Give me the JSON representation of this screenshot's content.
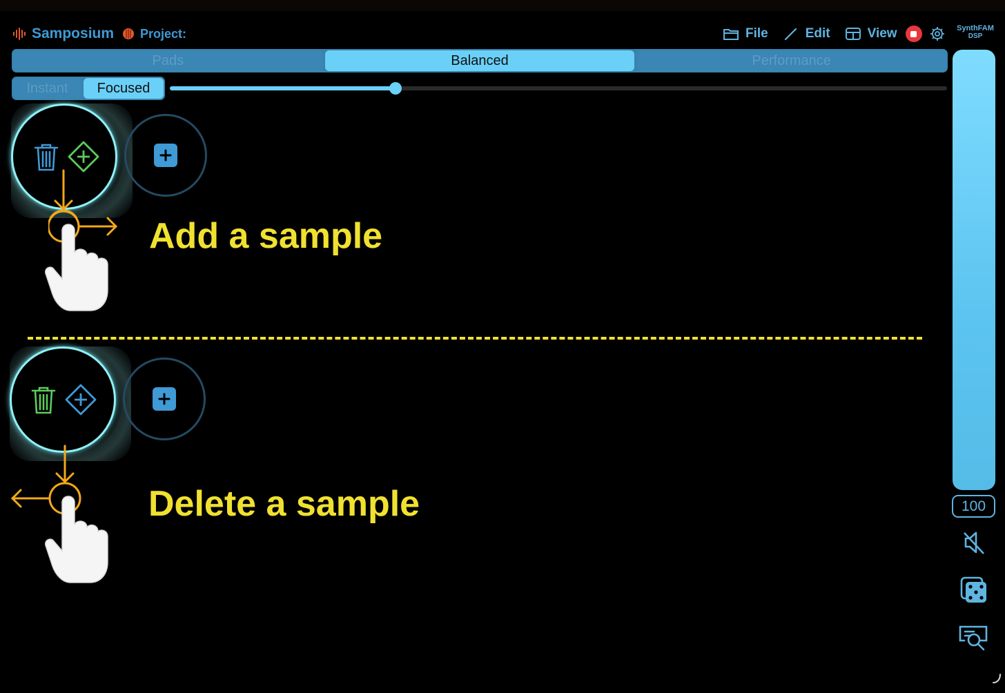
{
  "app": {
    "name": "Samposium",
    "project_label": "Project:",
    "brand_line1": "SynthFAM",
    "brand_line2": "DSP"
  },
  "menu": {
    "file": "File",
    "edit": "Edit",
    "view": "View"
  },
  "modes": {
    "items": [
      "Pads",
      "Balanced",
      "Performance"
    ],
    "selected": "Balanced"
  },
  "touch_modes": {
    "items": [
      "Instant",
      "Focused"
    ],
    "selected": "Focused"
  },
  "slider": {
    "value_fraction": 0.29
  },
  "volume": {
    "value": "100",
    "level_fraction": 1.0
  },
  "hints": {
    "add": "Add a sample",
    "delete": "Delete a sample"
  },
  "icons": {
    "trash": "trash-icon",
    "add_diamond": "add-diamond-icon",
    "add_square": "plus-square-icon",
    "mute": "speaker-muted-icon",
    "dice": "dice-icon",
    "search": "search-chat-icon",
    "gear": "gear-icon",
    "stop": "stop-record-icon",
    "hand": "hand-pointer-icon"
  },
  "colors": {
    "accent": "#5fb4e0",
    "active_segment": "#6ad0f8",
    "highlight_green": "#5ccc5c",
    "hint_yellow": "#f0e130",
    "gesture_orange": "#f2a81a",
    "record_red": "#e8383b"
  }
}
